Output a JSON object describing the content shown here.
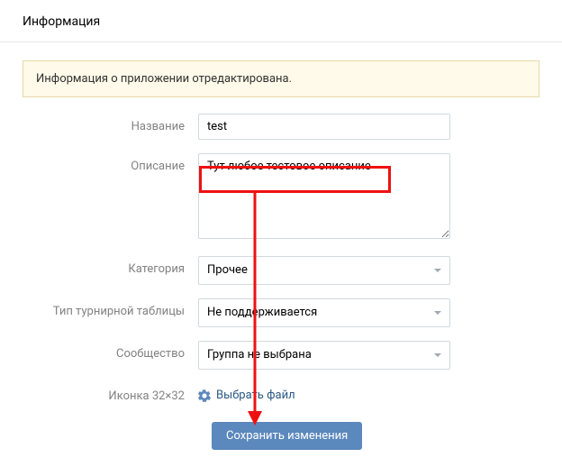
{
  "header": {
    "title": "Информация"
  },
  "notice": {
    "text": "Информация о приложении отредактирована."
  },
  "form": {
    "name": {
      "label": "Название",
      "value": "test"
    },
    "description": {
      "label": "Описание",
      "value": "Тут любое тестовое описание"
    },
    "category": {
      "label": "Категория",
      "selected": "Прочее"
    },
    "ranking": {
      "label": "Тип турнирной таблицы",
      "selected": "Не поддерживается"
    },
    "community": {
      "label": "Сообщество",
      "selected": "Группа не выбрана"
    },
    "icon": {
      "label": "Иконка 32×32",
      "choose_label": "Выбрать файл"
    },
    "submit_label": "Сохранить изменения"
  }
}
